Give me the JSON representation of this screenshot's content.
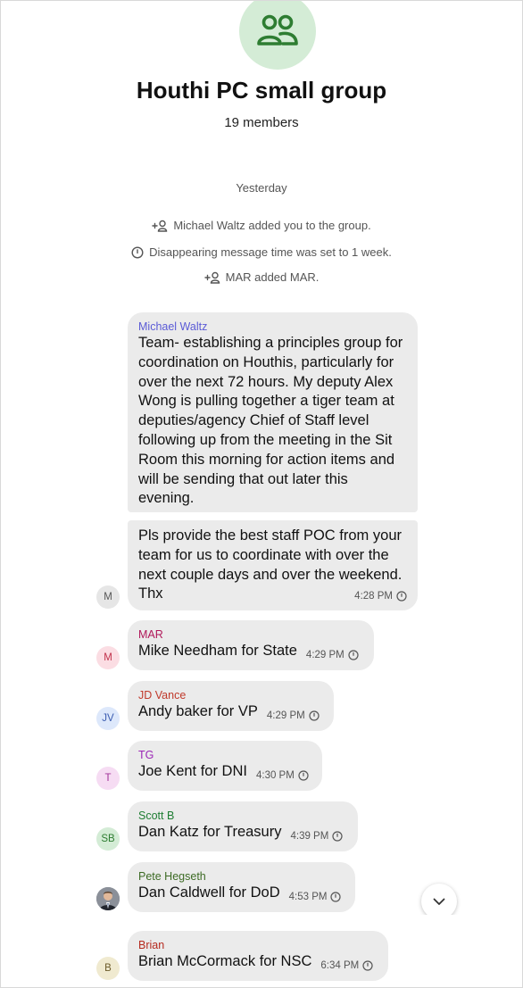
{
  "group": {
    "title": "Houthi PC small group",
    "members": "19 members"
  },
  "day_separator": "Yesterday",
  "system_events": [
    {
      "icon": "add-person-icon",
      "text": "Michael Waltz added you to the group."
    },
    {
      "icon": "timer-icon",
      "text": "Disappearing message time was set to 1 week."
    },
    {
      "icon": "add-person-icon",
      "text": "MAR added MAR."
    }
  ],
  "messages": [
    {
      "sender": "Michael Waltz",
      "sender_color": "#5b5bd6",
      "avatar": "M",
      "part1": "Team- establishing a principles group for coordination on Houthis, particularly for over the next 72 hours. My deputy Alex Wong is pulling together a tiger team at deputies/agency Chief of Staff level following up from the meeting in the Sit Room this morning for action items and will be sending that out later this evening.",
      "part2": "Pls provide the best staff POC from your team for us to coordinate with over the next couple days and over the weekend. Thx",
      "time": "4:28 PM"
    },
    {
      "sender": "MAR",
      "sender_color": "#b0185a",
      "avatar": "M",
      "avatar_bg": "#fbdde3",
      "avatar_fg": "#c0304a",
      "text": "Mike Needham for State",
      "time": "4:29 PM"
    },
    {
      "sender": "JD Vance",
      "sender_color": "#c0392b",
      "avatar": "JV",
      "avatar_bg": "#dde8fb",
      "avatar_fg": "#3a5bb0",
      "text": "Andy baker for VP",
      "time": "4:29 PM"
    },
    {
      "sender": "TG",
      "sender_color": "#9b26b6",
      "avatar": "T",
      "avatar_bg": "#f6dcf3",
      "avatar_fg": "#a3339a",
      "text": "Joe Kent for DNI",
      "time": "4:30 PM"
    },
    {
      "sender": "Scott B",
      "sender_color": "#1e7d32",
      "avatar": "SB",
      "avatar_bg": "#d4ecd6",
      "avatar_fg": "#2e7d32",
      "text": "Dan Katz for Treasury",
      "time": "4:39 PM"
    },
    {
      "sender": "Pete Hegseth",
      "sender_color": "#3d6b25",
      "avatar": "photo",
      "text": "Dan Caldwell for DoD",
      "time": "4:53 PM"
    },
    {
      "sender": "Brian",
      "sender_color": "#b5291e",
      "avatar": "B",
      "avatar_bg": "#f0ead0",
      "avatar_fg": "#6b5b2a",
      "text": "Brian McCormack for NSC",
      "time": "6:34 PM"
    }
  ]
}
